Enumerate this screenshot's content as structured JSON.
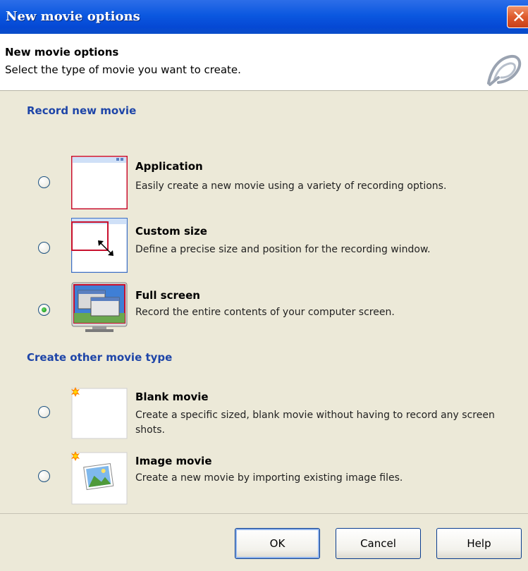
{
  "window": {
    "title": "New movie options"
  },
  "header": {
    "title": "New movie options",
    "subtitle": "Select the type of movie you want to create."
  },
  "sections": {
    "record": {
      "title": "Record new movie",
      "options": [
        {
          "label": "Application",
          "description": "Easily create a new movie using a variety of recording options.",
          "selected": false
        },
        {
          "label": "Custom size",
          "description": "Define a precise size and position for the recording window.",
          "selected": false
        },
        {
          "label": "Full screen",
          "description": "Record the entire contents of your computer screen.",
          "selected": true
        }
      ]
    },
    "other": {
      "title": "Create other movie type",
      "options": [
        {
          "label": "Blank movie",
          "description": "Create a specific sized, blank movie without having to record any screen shots.",
          "selected": false
        },
        {
          "label": "Image movie",
          "description": "Create a new movie by importing existing image files.",
          "selected": false
        }
      ]
    }
  },
  "buttons": {
    "ok": "OK",
    "cancel": "Cancel",
    "help": "Help"
  },
  "icons": {
    "close": "close-icon",
    "logo": "captivate-logo-icon",
    "application": "application-window-icon",
    "custom_size": "custom-size-icon",
    "full_screen": "full-screen-icon",
    "blank_movie": "blank-movie-icon",
    "image_movie": "image-movie-icon"
  },
  "colors": {
    "titlebar": "#0b58e0",
    "section_title": "#1e45a8",
    "dialog_bg": "#ece9d8",
    "selection_frame": "#c8102e"
  }
}
